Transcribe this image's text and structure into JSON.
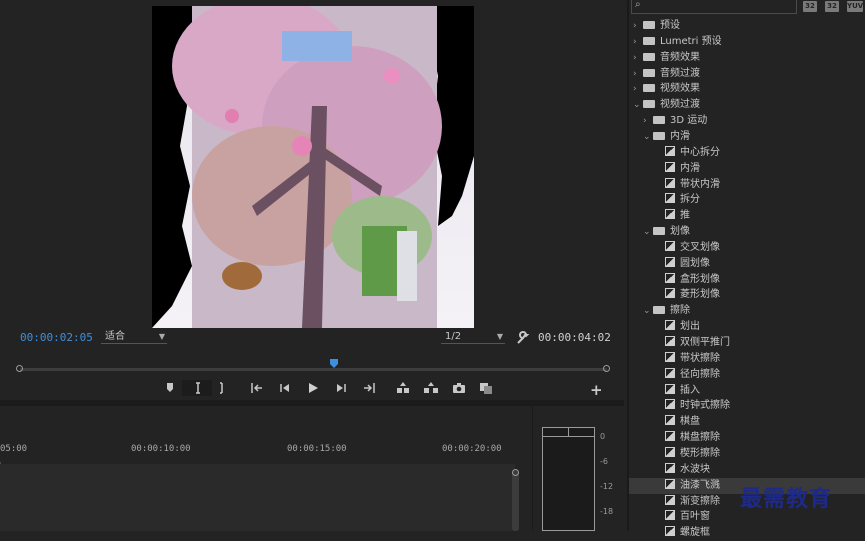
{
  "monitor": {
    "current_timecode": "00:00:02:05",
    "duration_timecode": "00:00:04:02",
    "fit_label": "适合",
    "resolution_label": "1/2"
  },
  "timeline": {
    "ruler_labels": [
      "05:00",
      "00:00:10:00",
      "00:00:15:00",
      "00:00:20:00"
    ]
  },
  "meter": {
    "db_labels": [
      "0",
      "-6",
      "-12",
      "-18"
    ]
  },
  "effects_panel": {
    "toolbar_buttons": [
      "32",
      "32",
      "YUV"
    ],
    "tree": [
      {
        "label": "预设",
        "type": "folder",
        "level": 0,
        "expanded": false
      },
      {
        "label": "Lumetri 预设",
        "type": "folder",
        "level": 0,
        "expanded": false
      },
      {
        "label": "音频效果",
        "type": "folder",
        "level": 0,
        "expanded": false
      },
      {
        "label": "音频过渡",
        "type": "folder",
        "level": 0,
        "expanded": false
      },
      {
        "label": "视频效果",
        "type": "folder",
        "level": 0,
        "expanded": false
      },
      {
        "label": "视频过渡",
        "type": "folder",
        "level": 0,
        "expanded": true
      },
      {
        "label": "3D 运动",
        "type": "folder",
        "level": 1,
        "expanded": false
      },
      {
        "label": "内滑",
        "type": "folder",
        "level": 1,
        "expanded": true
      },
      {
        "label": "中心拆分",
        "type": "effect",
        "level": 2
      },
      {
        "label": "内滑",
        "type": "effect",
        "level": 2
      },
      {
        "label": "带状内滑",
        "type": "effect",
        "level": 2
      },
      {
        "label": "拆分",
        "type": "effect",
        "level": 2
      },
      {
        "label": "推",
        "type": "effect",
        "level": 2
      },
      {
        "label": "划像",
        "type": "folder",
        "level": 1,
        "expanded": true
      },
      {
        "label": "交叉划像",
        "type": "effect",
        "level": 2
      },
      {
        "label": "圆划像",
        "type": "effect",
        "level": 2
      },
      {
        "label": "盒形划像",
        "type": "effect",
        "level": 2
      },
      {
        "label": "菱形划像",
        "type": "effect",
        "level": 2
      },
      {
        "label": "擦除",
        "type": "folder",
        "level": 1,
        "expanded": true
      },
      {
        "label": "划出",
        "type": "effect",
        "level": 2
      },
      {
        "label": "双侧平推门",
        "type": "effect",
        "level": 2
      },
      {
        "label": "带状擦除",
        "type": "effect",
        "level": 2
      },
      {
        "label": "径向擦除",
        "type": "effect",
        "level": 2
      },
      {
        "label": "插入",
        "type": "effect",
        "level": 2
      },
      {
        "label": "时钟式擦除",
        "type": "effect",
        "level": 2
      },
      {
        "label": "棋盘",
        "type": "effect",
        "level": 2
      },
      {
        "label": "棋盘擦除",
        "type": "effect",
        "level": 2
      },
      {
        "label": "楔形擦除",
        "type": "effect",
        "level": 2
      },
      {
        "label": "水波块",
        "type": "effect",
        "level": 2
      },
      {
        "label": "油漆飞溅",
        "type": "effect",
        "level": 2,
        "selected": true
      },
      {
        "label": "渐变擦除",
        "type": "effect",
        "level": 2
      },
      {
        "label": "百叶窗",
        "type": "effect",
        "level": 2
      },
      {
        "label": "螺旋框",
        "type": "effect",
        "level": 2
      }
    ]
  },
  "watermark": "最需教育",
  "colors": {
    "accent": "#3d8fe0",
    "panel_bg": "#232323"
  }
}
